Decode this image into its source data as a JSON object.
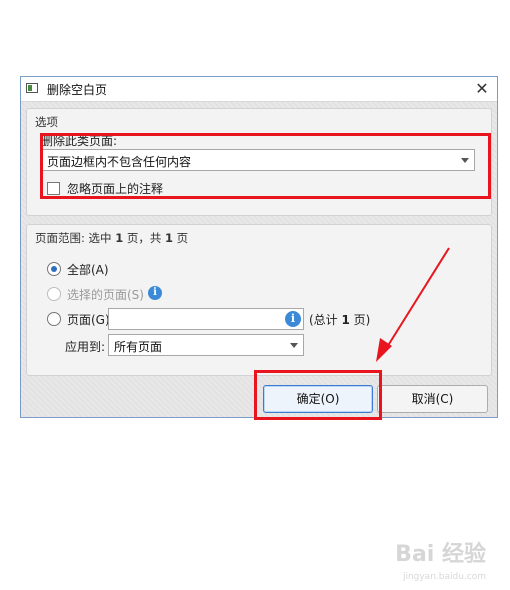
{
  "window": {
    "title": "删除空白页",
    "close_glyph": "✕"
  },
  "options": {
    "group_title": "选项",
    "delete_label": "删除此类页面:",
    "delete_type_value": "页面边框内不包含任何内容",
    "ignore_annotations_label": "忽略页面上的注释",
    "ignore_annotations_checked": false
  },
  "range": {
    "header_prefix": "页面范围: 选中 ",
    "header_selected": "1",
    "header_middle": " 页，共 ",
    "header_total": "1",
    "header_suffix": " 页",
    "all_label": "全部(A)",
    "selected_pages_label": "选择的页面(S)",
    "pages_label": "页面(G)",
    "pages_value": "",
    "total_prefix": "(总计 ",
    "total_count": "1",
    "total_suffix": " 页)",
    "apply_to_label": "应用到:",
    "apply_to_value": "所有页面",
    "selected_option": "all"
  },
  "buttons": {
    "ok": "确定(O)",
    "cancel": "取消(C)"
  },
  "icons": {
    "info": "i"
  },
  "colors": {
    "highlight": "#e8141e",
    "accent": "#2c6fbe",
    "info": "#3b8ad8"
  },
  "watermark": {
    "brand": "Bai 经验",
    "url": "jingyan.baidu.com"
  }
}
